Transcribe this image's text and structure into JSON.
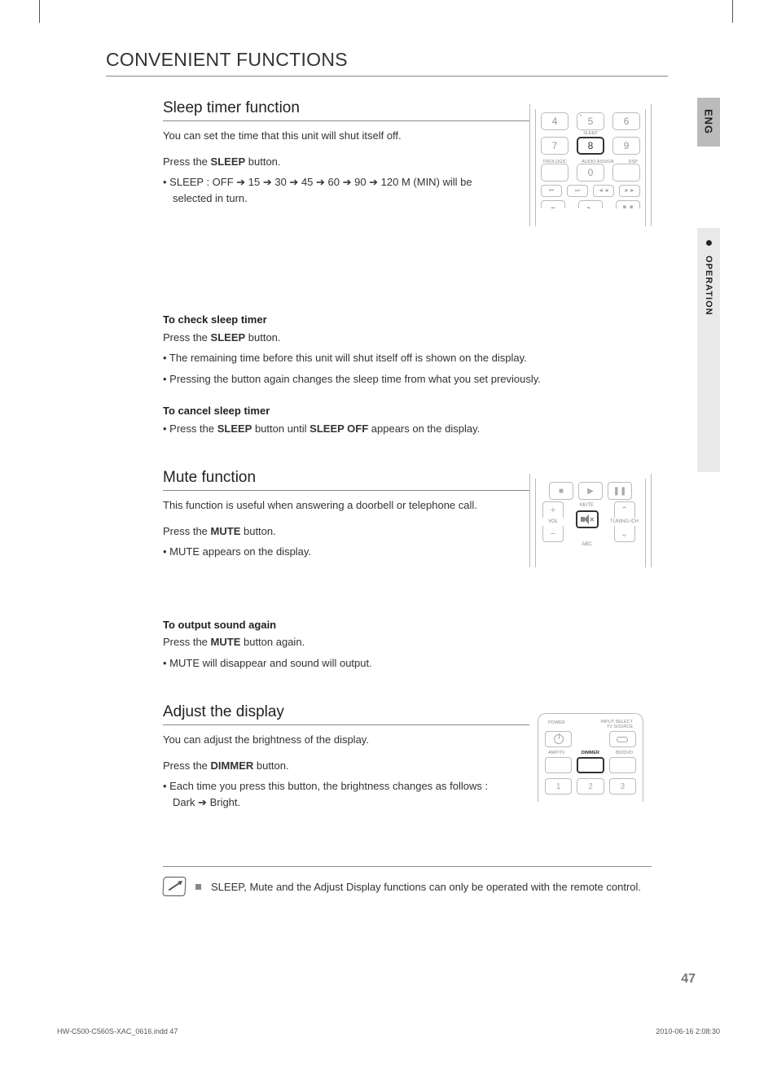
{
  "lang_tab": "ENG",
  "side_tab": "OPERATION",
  "main_title": "CONVENIENT FUNCTIONS",
  "sleep": {
    "title": "Sleep timer function",
    "desc": "You can set the time that this unit will shut itself off.",
    "press_prefix": "Press the ",
    "press_bold": "SLEEP",
    "press_suffix": " button.",
    "bullet1": "• SLEEP : OFF ➔ 15 ➔ 30 ➔ 45 ➔ 60 ➔ 90 ➔ 120 M (MIN) will be selected in turn.",
    "check_head": "To check sleep timer",
    "check_press_prefix": "Press the ",
    "check_press_bold": "SLEEP",
    "check_press_suffix": " button.",
    "check_b1": "• The remaining time before this unit will shut itself off is shown on the display.",
    "check_b2": "• Pressing the button again changes the sleep time from what you set previously.",
    "cancel_head": "To cancel sleep timer",
    "cancel_prefix": "• Press the ",
    "cancel_bold1": "SLEEP",
    "cancel_mid": " button until ",
    "cancel_bold2": "SLEEP OFF",
    "cancel_suffix": " appears on the display."
  },
  "mute": {
    "title": "Mute function",
    "desc": "This function is useful when answering a doorbell or telephone call.",
    "press_prefix": "Press the ",
    "press_bold": "MUTE",
    "press_suffix": " button.",
    "b1": "• MUTE appears on the display.",
    "again_head": "To output sound again",
    "again_press_prefix": "Press the ",
    "again_press_bold": "MUTE",
    "again_press_suffix": " button again.",
    "again_b1": "• MUTE will disappear and sound will output."
  },
  "dimmer": {
    "title": "Adjust the display",
    "desc": "You can adjust the brightness of the display.",
    "press_prefix": "Press the ",
    "press_bold": "DIMMER",
    "press_suffix": " button.",
    "b1": "• Each time you press this button, the brightness changes as follows : Dark ➔ Bright."
  },
  "note": "SLEEP, Mute and the Adjust Display functions can only be operated with the remote control.",
  "page_num": "47",
  "footer_left": "HW-C500-C560S-XAC_0616.indd   47",
  "footer_right": "2010-06-16   2:08:30",
  "remote": {
    "sleep_label": "SLEEP",
    "prologic": "PROLOGIC",
    "audio_assign": "AUDIO ASSIGN",
    "dsp": "DSP",
    "mute_label": "MUTE",
    "vol": "VOL",
    "abc": "ABC",
    "tuning": "TUNING /CH",
    "power": "POWER",
    "input_select": "INPUT SELECT TV SOURCE",
    "amp_tv": "AMP/TV",
    "dimmer": "DIMMER",
    "bd_dvd": "BD/DVD"
  }
}
